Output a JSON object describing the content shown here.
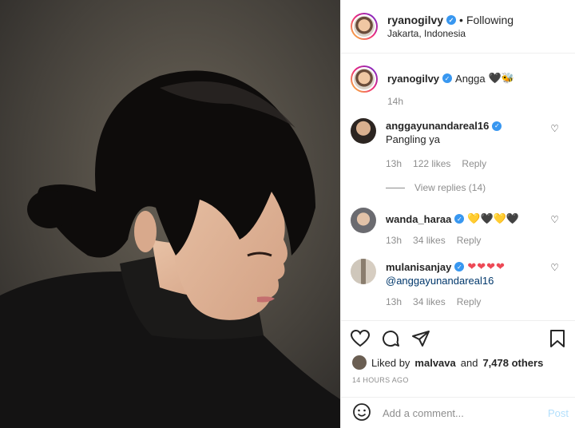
{
  "colors": {
    "accent": "#3897f0",
    "like_red": "#ed4956",
    "muted": "#8e8e8e",
    "link": "#00376b",
    "post_disabled": "#b2dffc"
  },
  "header": {
    "username": "ryanogilvy",
    "separator": "•",
    "follow_status": "Following",
    "location": "Jakarta, Indonesia"
  },
  "caption": {
    "username": "ryanogilvy",
    "text": "Angga",
    "emoji": "🖤🐝",
    "time": "14h"
  },
  "comments": [
    {
      "username": "anggayunandareal16",
      "text": "Pangling ya",
      "time": "13h",
      "likes": "122 likes",
      "reply": "Reply",
      "verified": true
    },
    {
      "username": "wanda_haraa",
      "text": "",
      "emoji": "💛🖤💛🖤",
      "time": "13h",
      "likes": "34 likes",
      "reply": "Reply",
      "verified": true
    },
    {
      "username": "mulanisanjay",
      "text": "@anggayunandareal16",
      "emoji": "❤❤❤❤",
      "time": "13h",
      "likes": "34 likes",
      "reply": "Reply",
      "verified": true
    }
  ],
  "view_replies": "View replies (14)",
  "actions": {
    "icons": [
      "heart-icon",
      "comment-icon",
      "share-icon",
      "bookmark-icon"
    ]
  },
  "likes": {
    "prefix": "Liked by",
    "user": "malvava",
    "middle": "and",
    "others": "7,478 others"
  },
  "timestamp": "14 HOURS AGO",
  "comment_box": {
    "placeholder": "Add a comment...",
    "post_label": "Post"
  }
}
